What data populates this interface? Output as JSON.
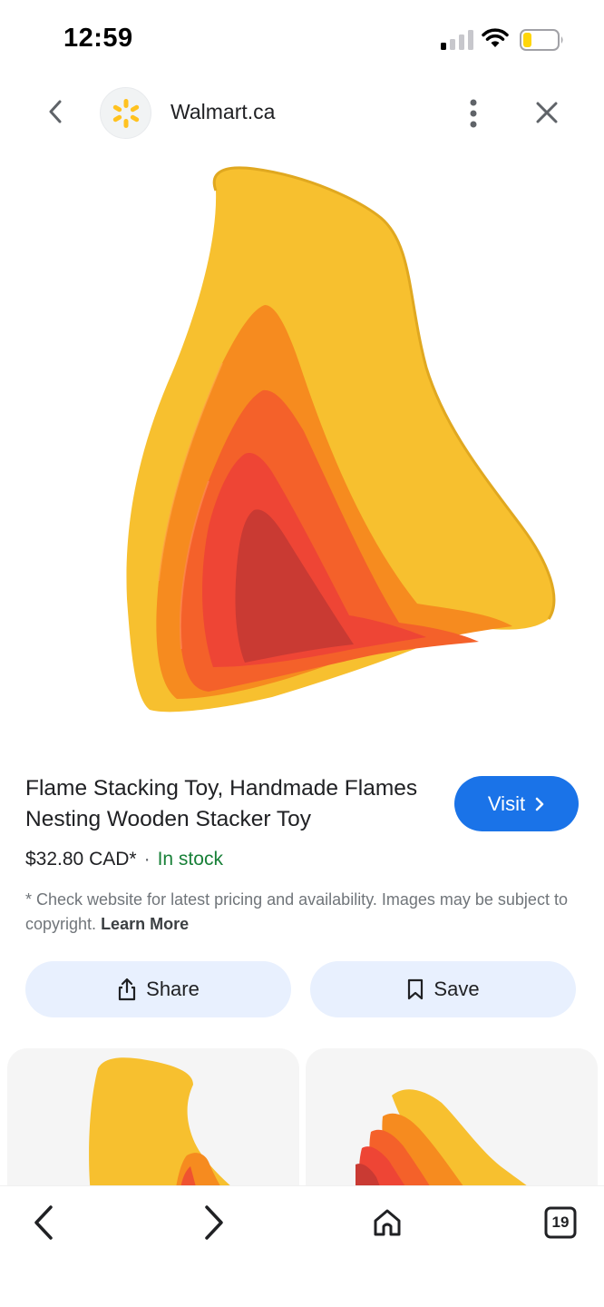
{
  "status_bar": {
    "time": "12:59",
    "icons": [
      "signal-icon",
      "wifi-icon",
      "battery-icon"
    ]
  },
  "header": {
    "site_name": "Walmart.ca",
    "icons": [
      "back-arrow-icon",
      "walmart-spark-logo",
      "more-vert-icon",
      "close-icon"
    ]
  },
  "product": {
    "title": "Flame Stacking Toy, Handmade Flames Nesting Wooden Stacker Toy",
    "price": "$32.80 CAD*",
    "separator": "·",
    "stock_status": "In stock",
    "visit_label": "Visit",
    "disclaimer": "* Check website for latest pricing and availability. Images may be subject to copyright.",
    "learn_more_label": "Learn More"
  },
  "actions": {
    "share_label": "Share",
    "save_label": "Save"
  },
  "bottom_nav": {
    "tab_count": "19",
    "icons": [
      "back-icon",
      "forward-icon",
      "home-icon",
      "tabs-icon"
    ]
  },
  "colors": {
    "visit_button": "#1a73e8",
    "in_stock": "#188038",
    "action_button_bg": "#e8f0fe",
    "walmart_spark": "#ffc220"
  }
}
